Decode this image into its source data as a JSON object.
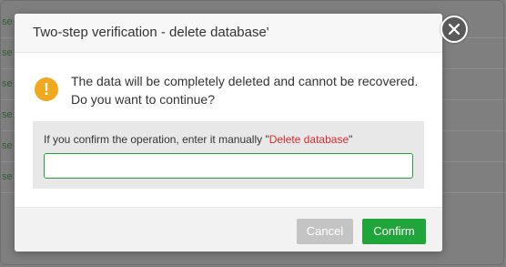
{
  "background": {
    "row_labels": [
      "se",
      "se",
      "se",
      "se",
      "se",
      "se"
    ]
  },
  "dialog": {
    "title": "Two-step verification - delete database'",
    "close_icon": "close-icon",
    "warning_icon": "exclamation-icon",
    "warning_symbol": "!",
    "message_line1": "The data will be completely deleted and cannot be recovered.",
    "message_line2": "Do you want to continue?",
    "confirm_prompt": "If you confirm the operation, enter it manually \"",
    "confirm_phrase": "Delete database",
    "confirm_prompt_end": "\"",
    "input_value": "",
    "cancel_label": "Cancel",
    "confirm_label": "Confirm",
    "colors": {
      "accent": "#20a53a",
      "warning": "#f0a81e",
      "danger_text": "#e0262c"
    }
  }
}
